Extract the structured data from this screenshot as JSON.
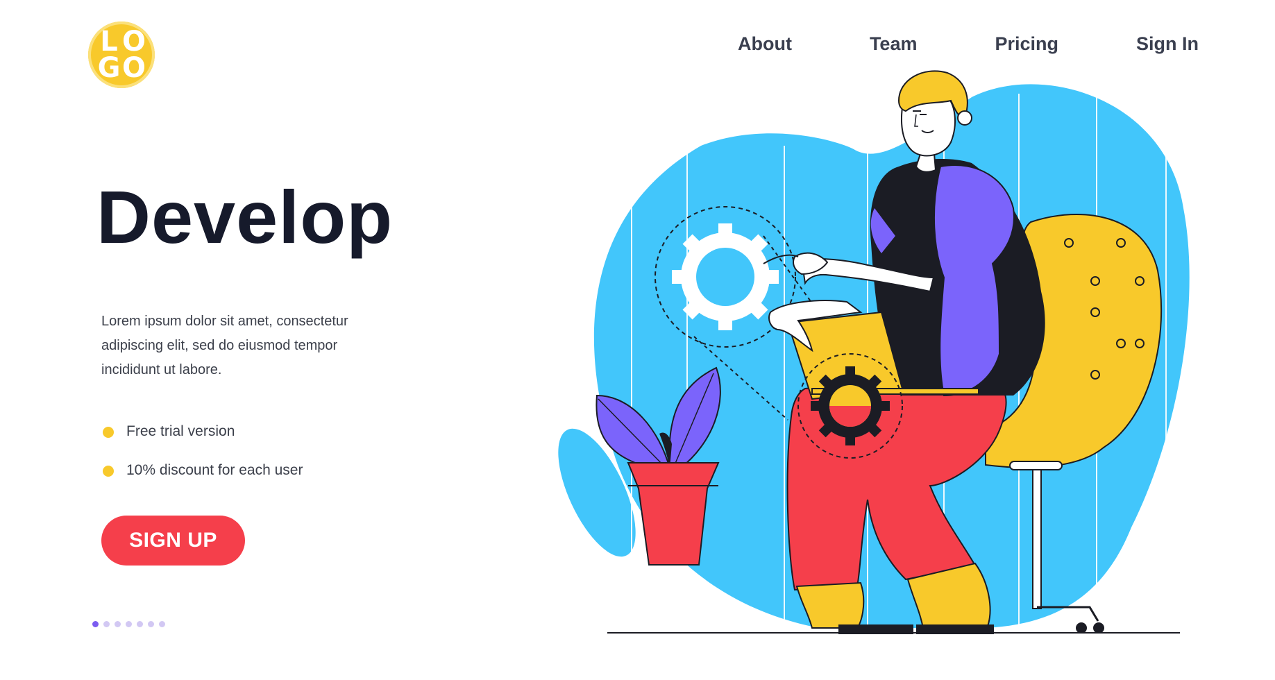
{
  "logo": {
    "letters": [
      "L",
      "O",
      "G",
      "O"
    ]
  },
  "nav": {
    "items": [
      {
        "label": "About"
      },
      {
        "label": "Team"
      },
      {
        "label": "Pricing"
      },
      {
        "label": "Sign In"
      }
    ]
  },
  "hero": {
    "title": "Develop",
    "description": "Lorem ipsum dolor sit amet, consectetur adipiscing elit, sed do eiusmod tempor incididunt ut labore.",
    "features": [
      {
        "label": "Free trial version",
        "icon": "bullet-dot"
      },
      {
        "label": "10% discount for each user",
        "icon": "bullet-dot"
      }
    ],
    "cta_label": "SIGN UP"
  },
  "carousel": {
    "total": 7,
    "active": 1
  },
  "colors": {
    "accent_yellow": "#f8c92b",
    "cta_red": "#f53f4b",
    "blob_blue": "#42c6fb",
    "shirt_purple": "#7b64fb",
    "dark": "#161a2b"
  }
}
